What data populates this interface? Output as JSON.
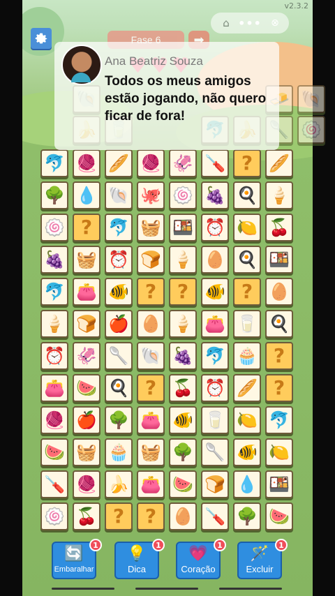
{
  "version": "v2.3.2",
  "level_label": "Fase 6",
  "top_controls": {
    "home_icon": "⌂",
    "more_icon": "•••",
    "close_icon": "⊗",
    "next_icon": "➡"
  },
  "hearts": [
    "♥",
    "♥",
    "♥"
  ],
  "chat": {
    "name": "Ana Beatriz Souza",
    "message": "Todos os meus amigos estão jogando, não quero ficar de fora!"
  },
  "top_partial_rows": [
    [
      "🐚",
      "",
      "",
      "",
      "",
      "",
      "🧈",
      "🐚"
    ],
    [
      "🍌",
      "🥛",
      "",
      "",
      "🐬",
      "🍌",
      "🥄",
      "🍥"
    ]
  ],
  "board": [
    [
      "🐬",
      "🧶",
      "🥖",
      "🧶",
      "🦑",
      "🪛",
      "?",
      "🥖"
    ],
    [
      "🌳",
      "💧",
      "🐚",
      "🐙",
      "🍥",
      "🍇",
      "🍳",
      "🍦"
    ],
    [
      "🍥",
      "?",
      "🐬",
      "🧺",
      "🍱",
      "⏰",
      "🍋",
      "🍒"
    ],
    [
      "🍇",
      "🧺",
      "⏰",
      "🍞",
      "🍦",
      "🥚",
      "🍳",
      "🍱"
    ],
    [
      "🐬",
      "👛",
      "🐠",
      "?",
      "?",
      "🐠",
      "?",
      "🥚"
    ],
    [
      "🍦",
      "🍞",
      "🍎",
      "🥚",
      "🍦",
      "👛",
      "🥛",
      "🍳"
    ],
    [
      "⏰",
      "🦑",
      "🥄",
      "🐚",
      "🍇",
      "🐬",
      "🧁",
      "?"
    ],
    [
      "👛",
      "🍉",
      "🍳",
      "?",
      "🍒",
      "⏰",
      "🥖",
      "?"
    ],
    [
      "🧶",
      "🍎",
      "🌳",
      "👛",
      "🐠",
      "🥛",
      "🍋",
      "🐬"
    ],
    [
      "🍉",
      "🧺",
      "🧁",
      "🧺",
      "🌳",
      "🥄",
      "🐠",
      "🍋"
    ],
    [
      "🪛",
      "🧶",
      "🍌",
      "👛",
      "🍉",
      "🍞",
      "💧",
      "🍱"
    ],
    [
      "🍥",
      "🍒",
      "?",
      "?",
      "🥚",
      "🪛",
      "🌳",
      "🍉"
    ]
  ],
  "tools": [
    {
      "label": "Embaralhar",
      "icon": "🔄",
      "badge": "1"
    },
    {
      "label": "Dica",
      "icon": "💡",
      "badge": "1"
    },
    {
      "label": "Coração",
      "icon": "💗",
      "badge": "1"
    },
    {
      "label": "Excluir",
      "icon": "🪄",
      "badge": "1"
    }
  ]
}
